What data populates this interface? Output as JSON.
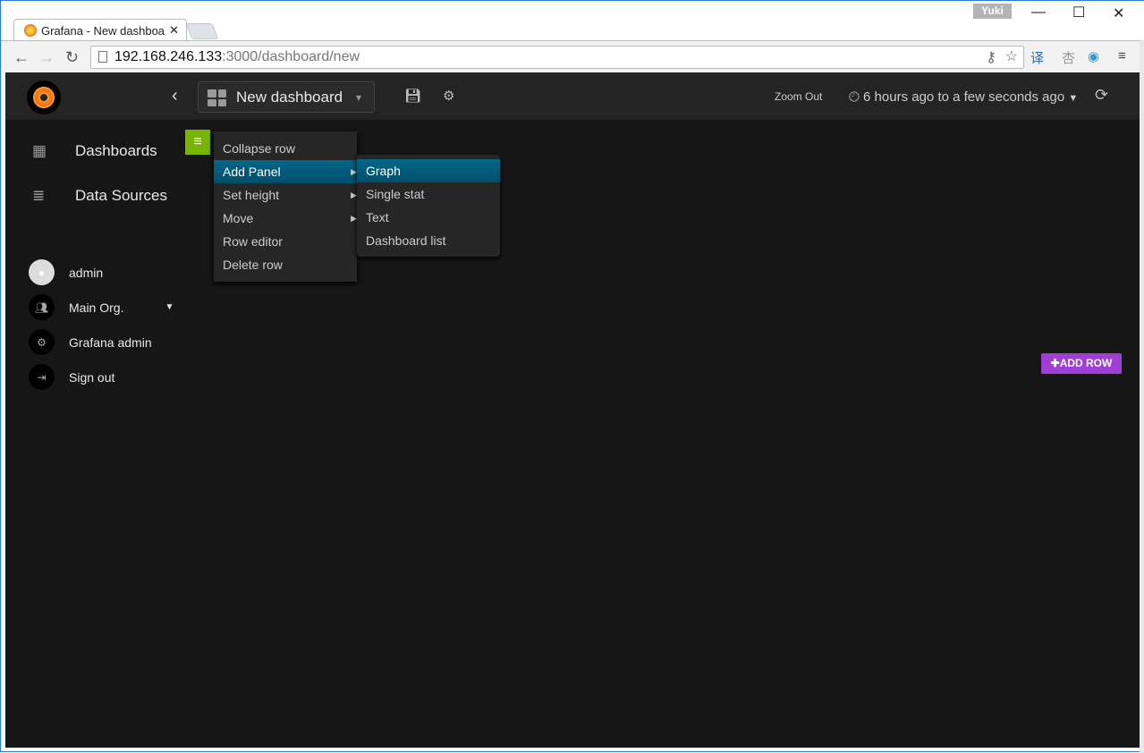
{
  "browser": {
    "tab_title": "Grafana - New dashboa",
    "url_host": "192.168.246.133",
    "url_path": ":3000/dashboard/new",
    "profile": "Yuki"
  },
  "topnav": {
    "dashboard_title": "New dashboard",
    "zoom_out": "Zoom Out",
    "time_range": "6 hours ago to a few seconds ago"
  },
  "sidebar": {
    "items": [
      {
        "label": "Dashboards"
      },
      {
        "label": "Data Sources"
      }
    ],
    "user": "admin",
    "org": "Main Org.",
    "grafana_admin": "Grafana admin",
    "sign_out": "Sign out"
  },
  "row_menu": {
    "items": [
      "Collapse row",
      "Add Panel",
      "Set height",
      "Move",
      "Row editor",
      "Delete row"
    ]
  },
  "panel_submenu": {
    "items": [
      "Graph",
      "Single stat",
      "Text",
      "Dashboard list"
    ]
  },
  "add_row": "ADD ROW",
  "colors": {
    "accent_active": "#00587a",
    "row_button": "#78b500",
    "add_row": "#a03fd8"
  }
}
